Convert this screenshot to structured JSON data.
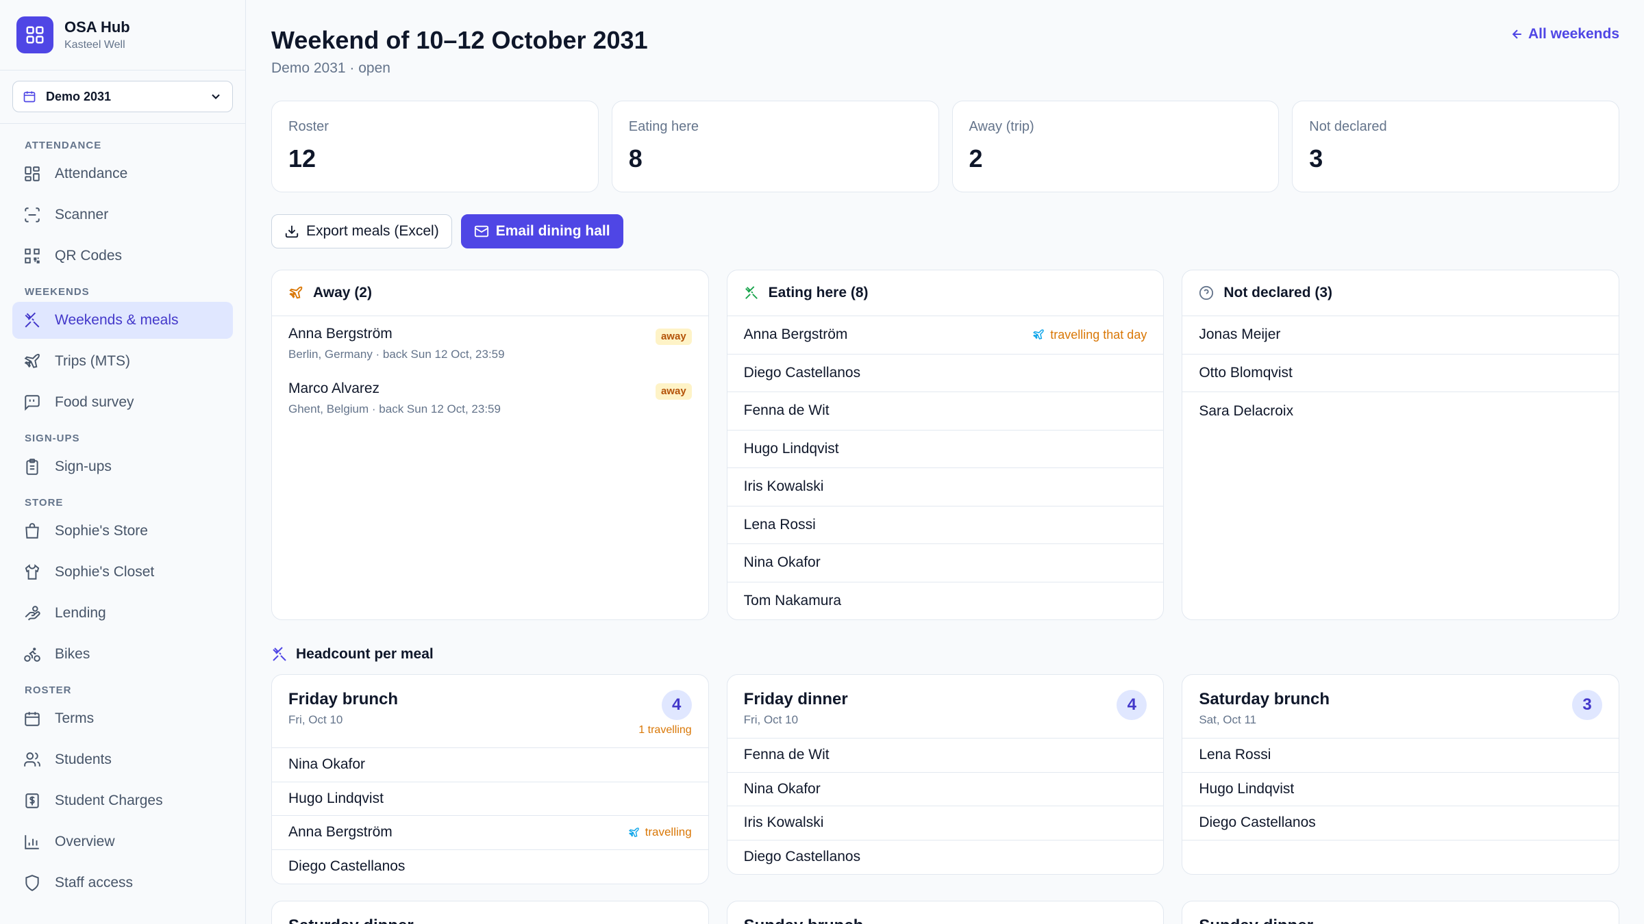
{
  "brand": {
    "title": "OSA Hub",
    "subtitle": "Kasteel Well"
  },
  "term_select": {
    "value": "Demo 2031"
  },
  "nav": {
    "attendance": {
      "label": "ATTENDANCE",
      "items": [
        "Attendance",
        "Scanner",
        "QR Codes"
      ]
    },
    "weekends": {
      "label": "WEEKENDS",
      "items": [
        "Weekends & meals",
        "Trips (MTS)",
        "Food survey"
      ]
    },
    "signups": {
      "label": "SIGN-UPS",
      "items": [
        "Sign-ups"
      ]
    },
    "store": {
      "label": "STORE",
      "items": [
        "Sophie's Store",
        "Sophie's Closet",
        "Lending",
        "Bikes"
      ]
    },
    "roster": {
      "label": "ROSTER",
      "items": [
        "Terms",
        "Students",
        "Student Charges",
        "Overview",
        "Staff access"
      ]
    }
  },
  "header": {
    "title": "Weekend of 10–12 October 2031",
    "subtitle": "Demo 2031 · open",
    "back_link": "All weekends"
  },
  "stats": [
    {
      "label": "Roster",
      "value": "12"
    },
    {
      "label": "Eating here",
      "value": "8"
    },
    {
      "label": "Away (trip)",
      "value": "2"
    },
    {
      "label": "Not declared",
      "value": "3"
    }
  ],
  "actions": {
    "export": "Export meals (Excel)",
    "email": "Email dining hall"
  },
  "away_panel": {
    "title": "Away (2)",
    "rows": [
      {
        "name": "Anna Bergström",
        "meta": "Berlin, Germany · back Sun 12 Oct, 23:59",
        "badge": "away"
      },
      {
        "name": "Marco Alvarez",
        "meta": "Ghent, Belgium · back Sun 12 Oct, 23:59",
        "badge": "away"
      }
    ]
  },
  "eating_panel": {
    "title": "Eating here (8)",
    "travel_note": "travelling that day",
    "rows": [
      "Anna Bergström",
      "Diego Castellanos",
      "Fenna de Wit",
      "Hugo Lindqvist",
      "Iris Kowalski",
      "Lena Rossi",
      "Nina Okafor",
      "Tom Nakamura"
    ]
  },
  "undeclared_panel": {
    "title": "Not declared (3)",
    "rows": [
      "Jonas Meijer",
      "Otto Blomqvist",
      "Sara Delacroix"
    ]
  },
  "headcount": {
    "title": "Headcount per meal",
    "meals": [
      {
        "name": "Friday brunch",
        "date": "Fri, Oct 10",
        "count": "4",
        "travelling": "1 travelling",
        "rows": [
          "Nina Okafor",
          "Hugo Lindqvist",
          "Anna Bergström",
          "Diego Castellanos"
        ],
        "row_travel_note": "travelling"
      },
      {
        "name": "Friday dinner",
        "date": "Fri, Oct 10",
        "count": "4",
        "rows": [
          "Fenna de Wit",
          "Nina Okafor",
          "Iris Kowalski",
          "Diego Castellanos"
        ]
      },
      {
        "name": "Saturday brunch",
        "date": "Sat, Oct 11",
        "count": "3",
        "rows": [
          "Lena Rossi",
          "Hugo Lindqvist",
          "Diego Castellanos"
        ]
      }
    ],
    "next_row": [
      {
        "name": "Saturday dinner"
      },
      {
        "name": "Sunday brunch"
      },
      {
        "name": "Sunday dinner"
      }
    ]
  },
  "colors": {
    "accent": "#4f46e5",
    "accent_soft": "#e0e7ff",
    "warning": "#d97706"
  }
}
